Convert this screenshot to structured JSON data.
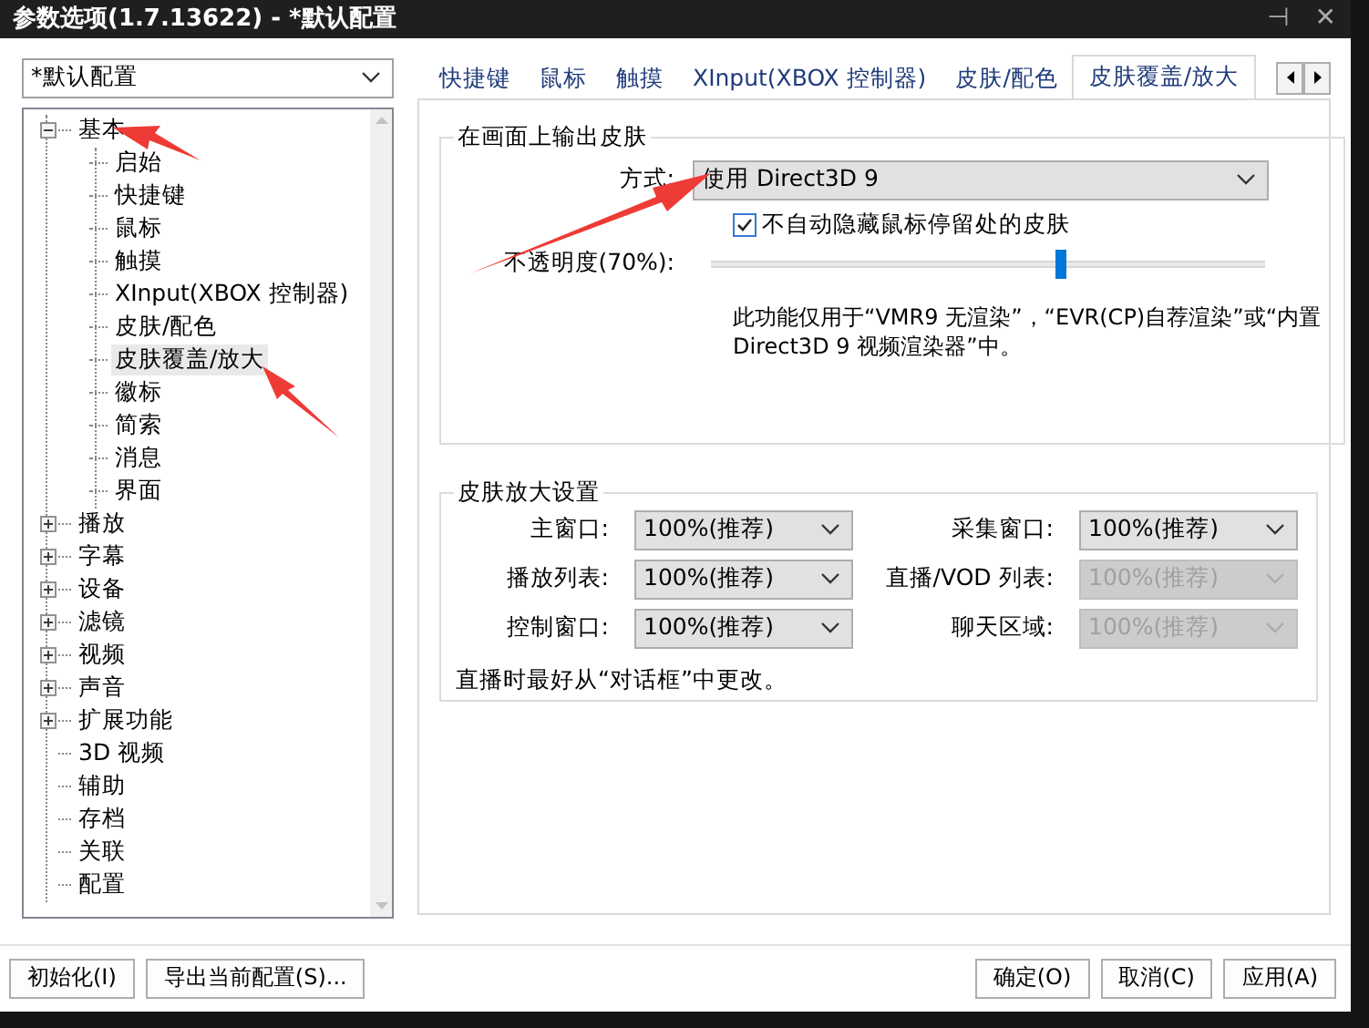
{
  "window": {
    "title": "参数选项(1.7.13622) - *默认配置",
    "pin": "⊣",
    "close": "✕"
  },
  "profile_combo": {
    "value": "*默认配置"
  },
  "tree": [
    {
      "label": "基本",
      "expanded": true,
      "selected": false,
      "children": [
        {
          "label": "启始",
          "selected": false
        },
        {
          "label": "快捷键",
          "selected": false
        },
        {
          "label": "鼠标",
          "selected": false
        },
        {
          "label": "触摸",
          "selected": false
        },
        {
          "label": "XInput(XBOX 控制器)",
          "selected": false
        },
        {
          "label": "皮肤/配色",
          "selected": false
        },
        {
          "label": "皮肤覆盖/放大",
          "selected": true
        },
        {
          "label": "徽标",
          "selected": false
        },
        {
          "label": "简索",
          "selected": false
        },
        {
          "label": "消息",
          "selected": false
        },
        {
          "label": "界面",
          "selected": false
        }
      ]
    },
    {
      "label": "播放",
      "expanded": false,
      "selected": false
    },
    {
      "label": "字幕",
      "expanded": false,
      "selected": false
    },
    {
      "label": "设备",
      "expanded": false,
      "selected": false
    },
    {
      "label": "滤镜",
      "expanded": false,
      "selected": false
    },
    {
      "label": "视频",
      "expanded": false,
      "selected": false
    },
    {
      "label": "声音",
      "expanded": false,
      "selected": false
    },
    {
      "label": "扩展功能",
      "expanded": false,
      "selected": false
    },
    {
      "label": "3D 视频",
      "selected": false
    },
    {
      "label": "辅助",
      "selected": false
    },
    {
      "label": "存档",
      "selected": false
    },
    {
      "label": "关联",
      "selected": false
    },
    {
      "label": "配置",
      "selected": false
    }
  ],
  "tabs": [
    {
      "label": "快捷键",
      "selected": false
    },
    {
      "label": "鼠标",
      "selected": false
    },
    {
      "label": "触摸",
      "selected": false
    },
    {
      "label": "XInput(XBOX 控制器)",
      "selected": false
    },
    {
      "label": "皮肤/配色",
      "selected": false
    },
    {
      "label": "皮肤覆盖/放大",
      "selected": true
    }
  ],
  "output_group": {
    "title": "在画面上输出皮肤",
    "method_label": "方式:",
    "method_value": "使用 Direct3D 9",
    "hide_checkbox": {
      "label": "不自动隐藏鼠标停留处的皮肤",
      "checked": true
    },
    "opacity_label": "不透明度(70%):",
    "opacity": {
      "level": 0.63
    },
    "note": "此功能仅用于“VMR9 无渲染”，“EVR(CP)自荐渲染”或“内置 Direct3D 9 视频渲染器”中。"
  },
  "zoom_group": {
    "title": "皮肤放大设置",
    "fields": [
      {
        "label": "主窗口:",
        "value": "100%(推荐)",
        "disabled": false
      },
      {
        "label": "采集窗口:",
        "value": "100%(推荐)",
        "disabled": false
      },
      {
        "label": "播放列表:",
        "value": "100%(推荐)",
        "disabled": false
      },
      {
        "label": "直播/VOD 列表:",
        "value": "100%(推荐)",
        "disabled": true
      },
      {
        "label": "控制窗口:",
        "value": "100%(推荐)",
        "disabled": false
      },
      {
        "label": "聊天区域:",
        "value": "100%(推荐)",
        "disabled": true
      }
    ],
    "note": "直播时最好从“对话框”中更改。"
  },
  "left_buttons": [
    "初始化(I)",
    "导出当前配置(S)..."
  ],
  "right_buttons": [
    "确定(O)",
    "取消(C)",
    "应用(A)"
  ]
}
